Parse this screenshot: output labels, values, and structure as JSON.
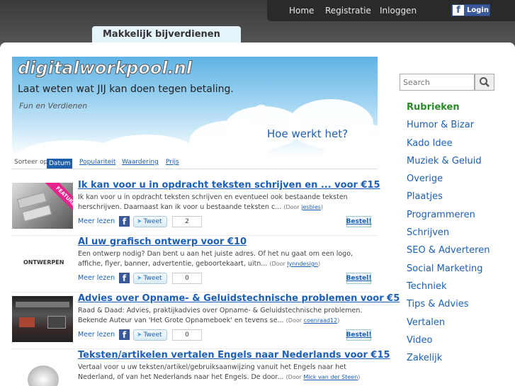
{
  "nav": {
    "home": "Home",
    "register": "Registratie",
    "login": "Inloggen",
    "fb_login": "Login",
    "fb_letter": "f"
  },
  "tagline_tab": "Makkelijk bijverdienen",
  "banner": {
    "logo": "digitalworkpool.nl",
    "slogan": "Laat weten wat JIJ kan doen tegen betaling.",
    "subtitle": "Fun en Verdienen",
    "how_link": "Hoe werkt het?",
    "euro": "€"
  },
  "sort": {
    "label": "Sorteer op",
    "options": [
      "Datum",
      "Populariteit",
      "Waardering",
      "Prijs"
    ]
  },
  "items": [
    {
      "title": "Ik kan voor u in opdracht teksten schrijven en ... voor €15",
      "desc": "Ik kan voor u in opdracht teksten schrijven en eventueel ook bestaande teksten herschrijven. Daarnaast kan ik voor u bestaande teksten c...",
      "by_prefix": "(Door ",
      "by_user": "jesbies",
      "by_suffix": ")",
      "more": "Meer lezen",
      "tweet": "Tweet",
      "count": "2",
      "order": "Bestel!",
      "thumb_label": "FEATURED"
    },
    {
      "title": "Al uw grafisch ontwerp voor €10",
      "desc": "Een ontwerp nodig? Dan bent u aan het juiste adres. Of het nu gaat om een logo, affiche, flyer, banner, advertentie, geboortekaart, uitn...",
      "by_prefix": "(Door ",
      "by_user": "lynndesign",
      "by_suffix": ")",
      "more": "Meer lezen",
      "tweet": "Tweet",
      "count": "0",
      "order": "Bestel!",
      "thumb_label": "ONTWERPEN"
    },
    {
      "title": "Advies over Opname- & Geluidstechnische problemen voor €5",
      "desc": "Raad & Daad: Advies, praktijkadvies over Opname- & Geluidstechnische problemen. Bekende Auteur van 'Het Grote Opnameboek' en tevens se...",
      "by_prefix": "(Door ",
      "by_user": "coenraad12",
      "by_suffix": ")",
      "more": "Meer lezen",
      "tweet": "Tweet",
      "count": "0",
      "order": "Bestel!"
    },
    {
      "title": "Teksten/artikelen vertalen Engels naar Nederlands voor €15",
      "desc": "Vertaal voor u uw teksten/artikel/gebruiksaanwijzing vanuit het Engels naar het Nederland, of van het Nederlands naar het Engels. De door...",
      "by_prefix": "(Door ",
      "by_user": "Mick van der Steen",
      "by_suffix": ")"
    }
  ],
  "search": {
    "placeholder": "Search"
  },
  "categories": {
    "heading": "Rubrieken",
    "items": [
      "Humor & Bizar",
      "Kado Idee",
      "Muziek & Geluid",
      "Overige",
      "Plaatjes",
      "Programmeren",
      "Schrijven",
      "SEO & Adverteren",
      "Social Marketing",
      "Techniek",
      "Tips & Advies",
      "Vertalen",
      "Video",
      "Zakelijk"
    ]
  },
  "colors": {
    "link": "#1c5fb8",
    "heading_green": "#2a8a2a",
    "facebook": "#3b5998"
  }
}
